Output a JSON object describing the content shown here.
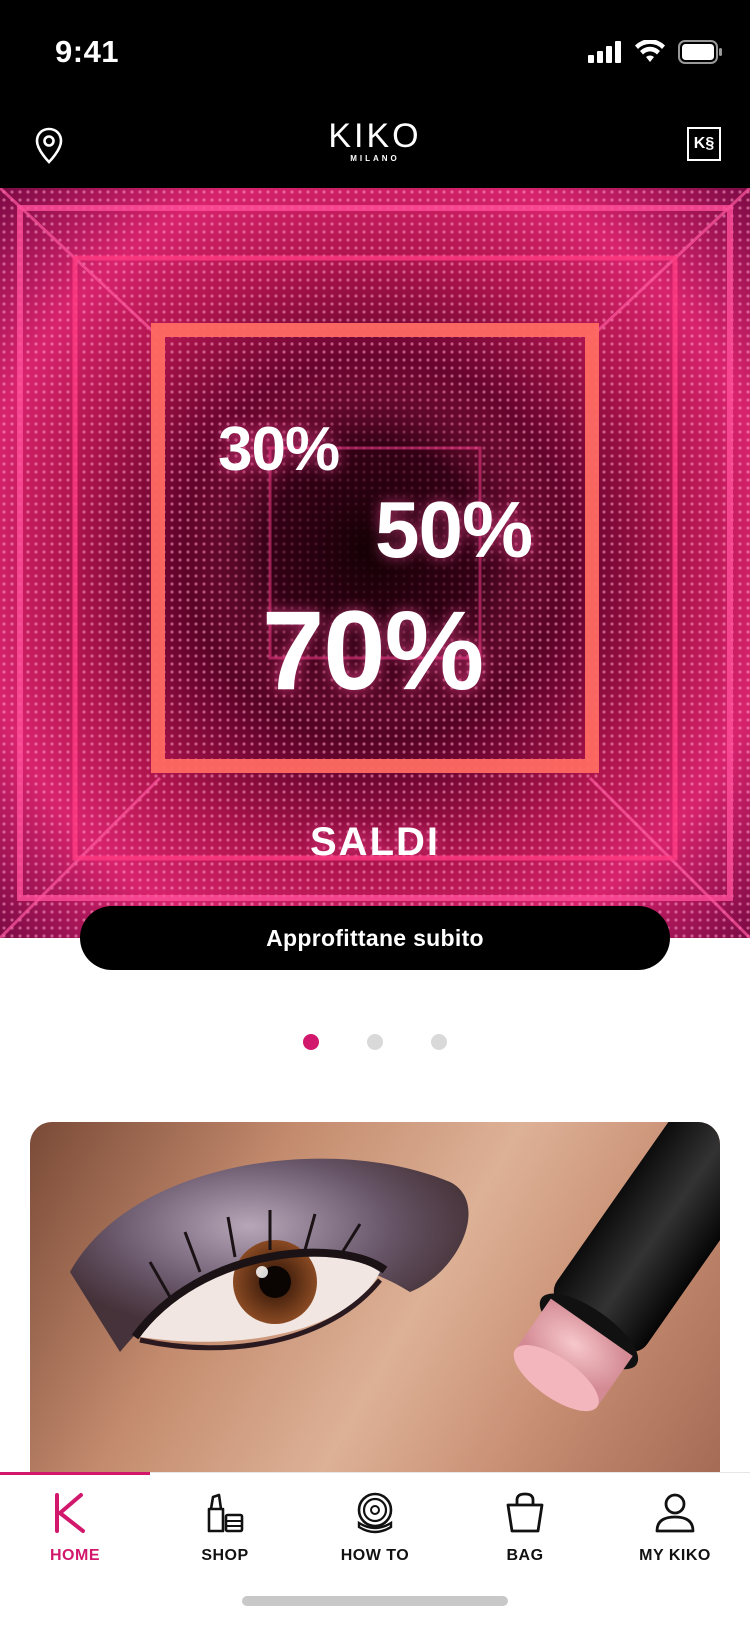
{
  "status_bar": {
    "time": "9:41"
  },
  "header": {
    "brand": "KIKO",
    "brand_sub": "MILANO",
    "ks_badge": "K§"
  },
  "hero": {
    "discounts": [
      "30%",
      "50%",
      "70%"
    ],
    "title": "SALDI",
    "cta_label": "Approfittane subito"
  },
  "carousel": {
    "page_count": 3,
    "active_index": 0
  },
  "colors": {
    "accent": "#d1186c",
    "hero_pink": "#d8236d",
    "header_bg": "#000000"
  },
  "tab_bar": {
    "items": [
      {
        "label": "HOME",
        "icon": "kiko-k-icon",
        "active": true
      },
      {
        "label": "SHOP",
        "icon": "lipstick-icon",
        "active": false
      },
      {
        "label": "HOW TO",
        "icon": "compact-mirror-icon",
        "active": false
      },
      {
        "label": "BAG",
        "icon": "shopping-bag-icon",
        "active": false
      },
      {
        "label": "MY KIKO",
        "icon": "user-icon",
        "active": false
      }
    ]
  }
}
